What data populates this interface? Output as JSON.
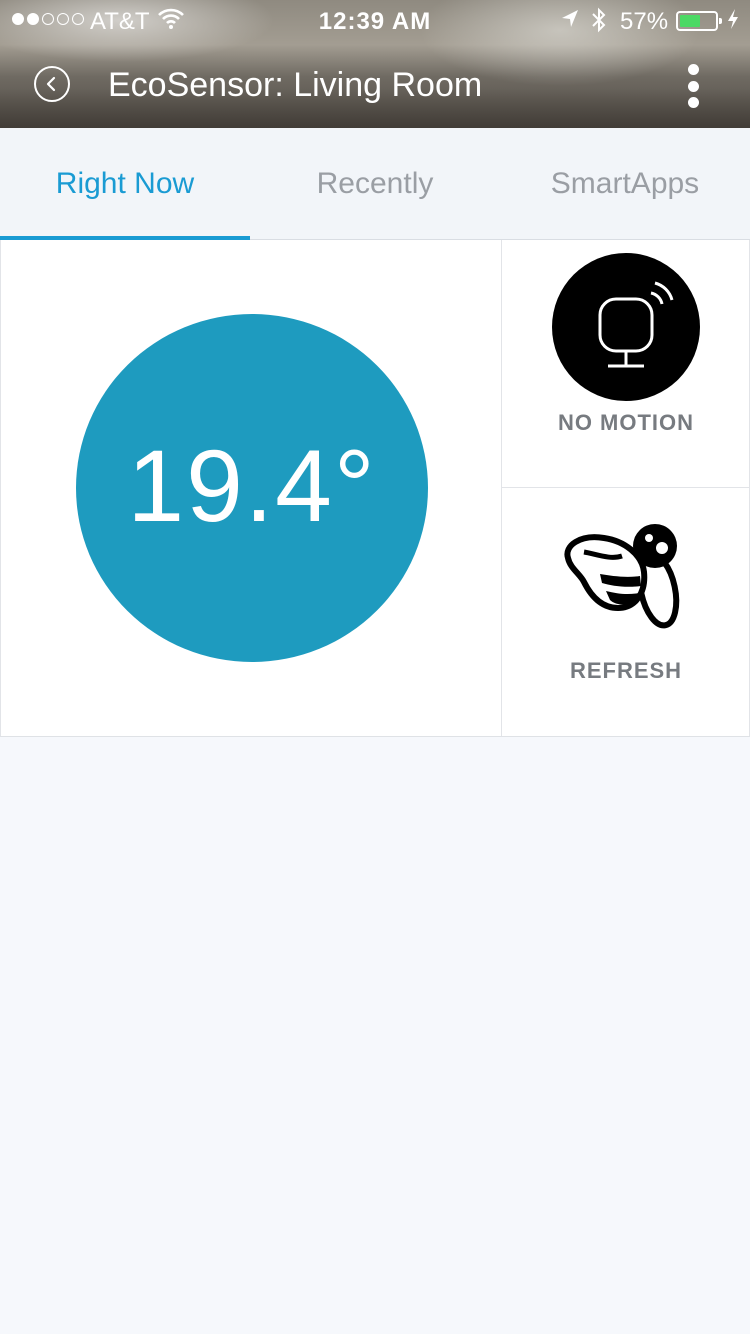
{
  "status_bar": {
    "carrier": "AT&T",
    "time": "12:39 AM",
    "battery_percent": "57%",
    "signal_bars_filled": 2,
    "signal_bars_total": 5,
    "battery_fill": 0.57,
    "battery_color": "#4cd964"
  },
  "nav": {
    "title": "EcoSensor: Living Room",
    "back_icon": "back-circle-icon",
    "more_icon": "more-vertical-icon"
  },
  "tabs": [
    {
      "label": "Right Now",
      "active": true
    },
    {
      "label": "Recently",
      "active": false
    },
    {
      "label": "SmartApps",
      "active": false
    }
  ],
  "tiles": {
    "temperature": "19.4°",
    "motion_label": "NO MOTION",
    "refresh_label": "REFRESH"
  },
  "colors": {
    "accent": "#1a9bd3",
    "temperature_circle": "#1e9bbf"
  }
}
